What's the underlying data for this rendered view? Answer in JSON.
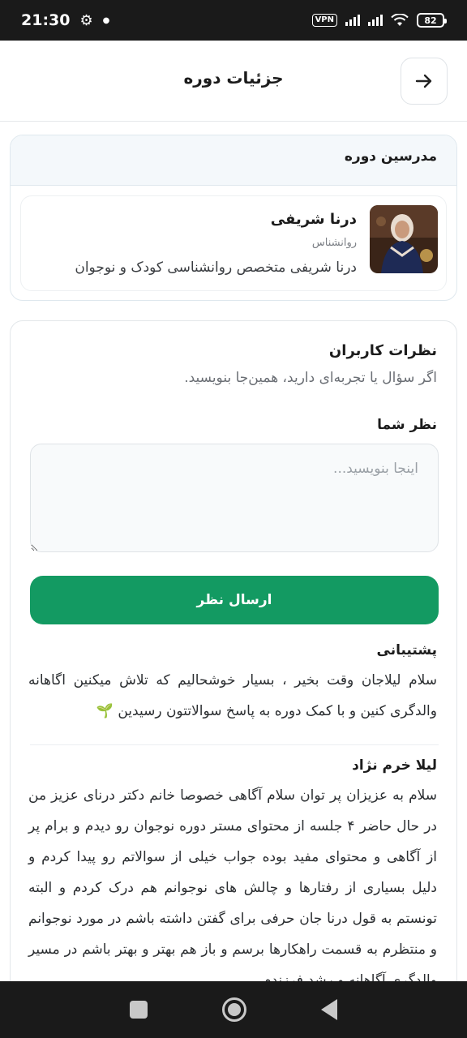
{
  "status_bar": {
    "time": "21:30",
    "vpn": "VPN",
    "battery": "82"
  },
  "header": {
    "title": "جزئیات دوره",
    "back_icon": "arrow-right-icon"
  },
  "instructors": {
    "heading": "مدرسین دوره",
    "items": [
      {
        "name": "درنا شریفی",
        "role": "روانشناس",
        "description": "درنا شریفی متخصص روانشناسی کودک و نوجوان"
      }
    ]
  },
  "comments": {
    "title": "نظرات کاربران",
    "subtitle": "اگر سؤال یا تجربه‌ای دارید، همین‌جا بنویسید.",
    "input_label": "نظر شما",
    "input_placeholder": "اینجا بنویسید...",
    "input_value": "",
    "submit_label": "ارسال نظر",
    "items": [
      {
        "author": "پشتیبانی",
        "text": "سلام لیلاجان وقت بخیر ، بسیار خوشحالیم که تلاش میکنین اگاهانه والدگری کنین و با کمک دوره به پاسخ سوالاتتون رسیدین 🌱"
      },
      {
        "author": "لیلا خرم نژاد",
        "text": "سلام به عزیزان پر توان سلام آگاهی خصوصا خانم دکتر درنای عزیز من در حال حاضر ۴ جلسه از محتوای مستر دوره نوجوان رو دیدم و برام پر از آگاهی و محتوای مفید بوده جواب خیلی از سوالاتم رو پیدا کردم و دلیل بسیاری از رفتارها و چالش های نوجوانم هم درک کردم و البته تونستم به قول درنا جان حرفی برای گفتن داشته باشم در مورد نوجوانم و منتظرم به قسمت راهکارها برسم و باز هم بهتر و بهتر باشم در مسیر والدگری آگاهانه و رشد فرزندم"
      }
    ]
  },
  "colors": {
    "accent": "#139a62",
    "header_bg": "#f4f8fb"
  }
}
